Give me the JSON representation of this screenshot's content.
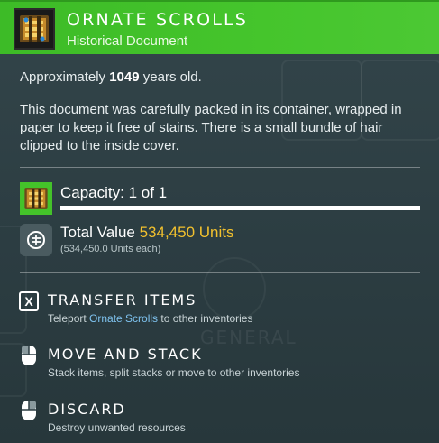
{
  "header": {
    "title": "Ornate Scrolls",
    "subtitle": "Historical Document",
    "icon": "scrolls-icon",
    "color": "#45c52c"
  },
  "age": {
    "prefix": "Approximately ",
    "years": "1049",
    "suffix": " years old."
  },
  "description": "This document was carefully packed in its container, wrapped in paper to keep it free of stains. There is a small bundle of hair clipped to the inside cover.",
  "capacity": {
    "label": "Capacity: 1 of 1",
    "current": 1,
    "max": 1
  },
  "value": {
    "label": "Total Value ",
    "amount": "534,450 Units",
    "each": "(534,450.0 Units each)",
    "amount_color": "#f2c12e"
  },
  "actions": [
    {
      "key": "X",
      "title": "Transfer Items",
      "desc_prefix": "Teleport ",
      "desc_highlight": "Ornate Scrolls",
      "desc_suffix": " to other inventories",
      "icon": "x-key-icon"
    },
    {
      "title": "Move and Stack",
      "desc": "Stack items, split stacks or move to other inventories",
      "icon": "mouse-icon"
    },
    {
      "title": "Discard",
      "desc": "Destroy unwanted resources",
      "icon": "mouse-icon"
    }
  ],
  "background": {
    "ghost_label": "GENERAL"
  }
}
